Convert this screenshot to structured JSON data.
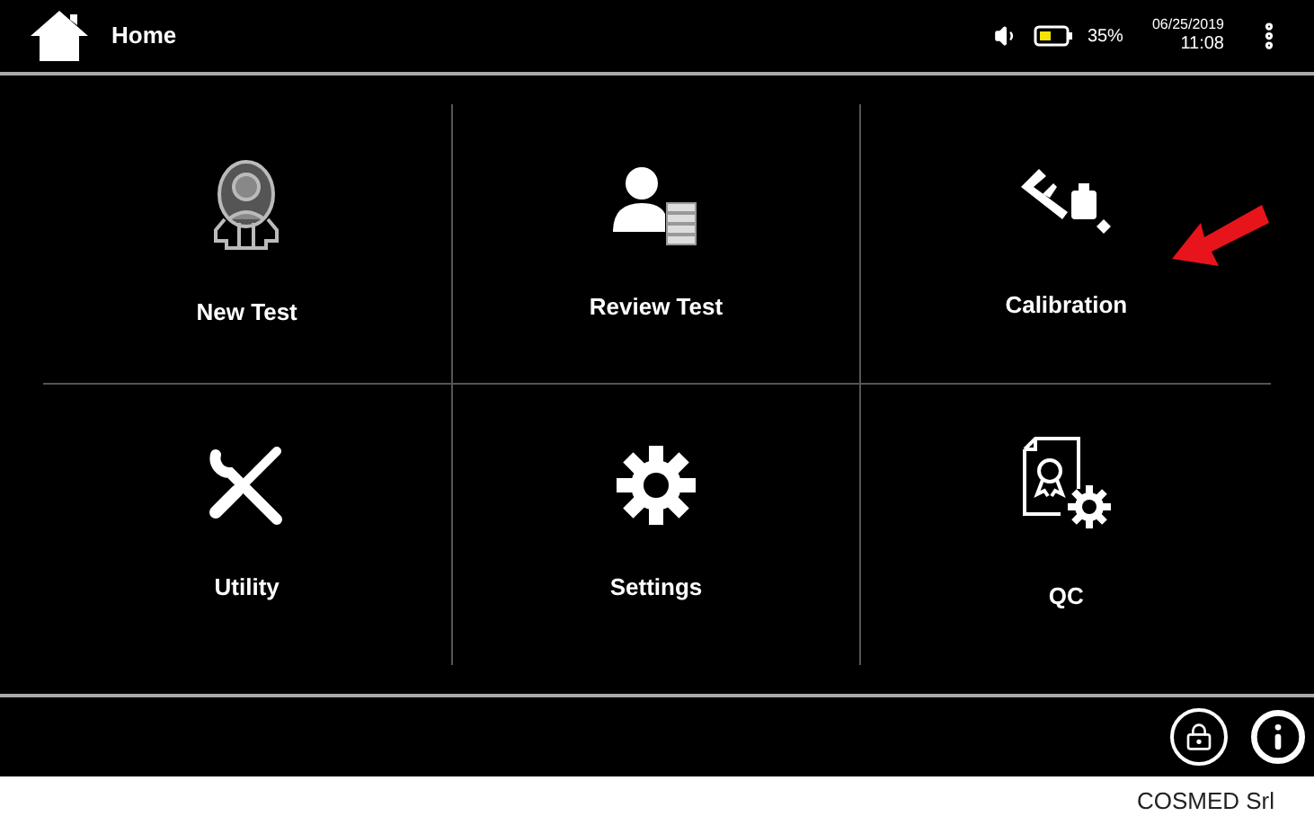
{
  "header": {
    "title": "Home",
    "battery": "35%",
    "date": "06/25/2019",
    "time": "11:08"
  },
  "tiles": [
    {
      "label": "New Test"
    },
    {
      "label": "Review Test"
    },
    {
      "label": "Calibration"
    },
    {
      "label": "Utility"
    },
    {
      "label": "Settings"
    },
    {
      "label": "QC"
    }
  ],
  "caption": "COSMED Srl"
}
